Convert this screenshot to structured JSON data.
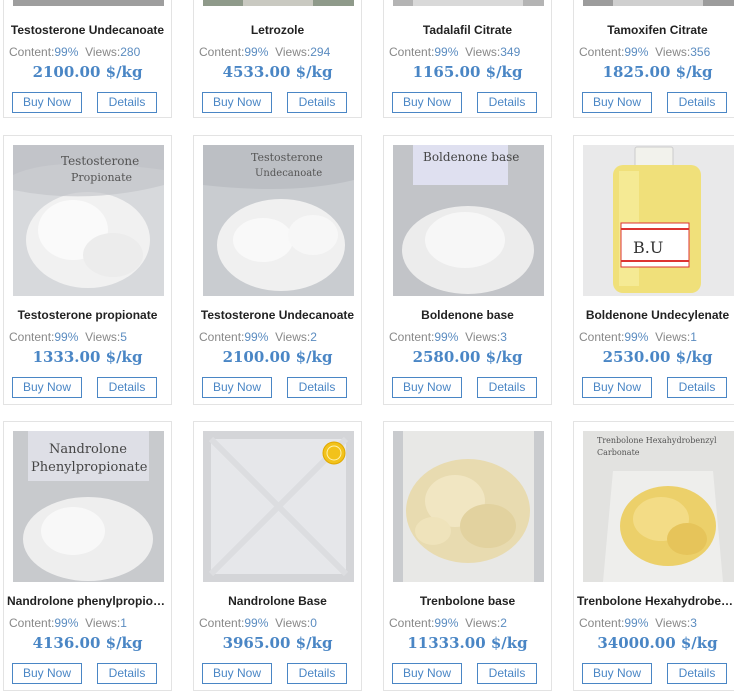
{
  "buttons": {
    "buy": "Buy Now",
    "details": "Details"
  },
  "labels": {
    "content": "Content:",
    "views": "Views:"
  },
  "products": [
    {
      "name": "Testosterone Undecanoate",
      "content": "99%",
      "views": "280",
      "price": "2100.00 $/kg"
    },
    {
      "name": "Letrozole",
      "content": "99%",
      "views": "294",
      "price": "4533.00 $/kg"
    },
    {
      "name": "Tadalafil Citrate",
      "content": "99%",
      "views": "349",
      "price": "1165.00 $/kg"
    },
    {
      "name": "Tamoxifen Citrate",
      "content": "99%",
      "views": "356",
      "price": "1825.00 $/kg"
    },
    {
      "name": "Testosterone propionate",
      "content": "99%",
      "views": "5",
      "price": "1333.00 $/kg",
      "photo_text": [
        "Testosterone",
        "Propionate"
      ]
    },
    {
      "name": "Testosterone Undecanoate",
      "content": "99%",
      "views": "2",
      "price": "2100.00 $/kg",
      "photo_text": [
        "Testosterone",
        "Undecanoate"
      ]
    },
    {
      "name": "Boldenone base",
      "content": "99%",
      "views": "3",
      "price": "2580.00 $/kg",
      "photo_text": [
        "Boldenone base"
      ]
    },
    {
      "name": "Boldenone Undecylenate",
      "content": "99%",
      "views": "1",
      "price": "2530.00 $/kg",
      "photo_text": [
        "B.U"
      ]
    },
    {
      "name": "Nandrolone phenylpropionate",
      "content": "99%",
      "views": "1",
      "price": "4136.00 $/kg",
      "photo_text": [
        "Nandrolone",
        "Phenylpropionate"
      ]
    },
    {
      "name": "Nandrolone Base",
      "content": "99%",
      "views": "0",
      "price": "3965.00 $/kg"
    },
    {
      "name": "Trenbolone base",
      "content": "99%",
      "views": "2",
      "price": "11333.00 $/kg"
    },
    {
      "name": "Trenbolone Hexahydrobenzylcarbonate",
      "content": "99%",
      "views": "3",
      "price": "34000.00 $/kg",
      "photo_text": [
        "Trenbolone Hexahydrobenzyl",
        "Carbonate"
      ]
    }
  ]
}
